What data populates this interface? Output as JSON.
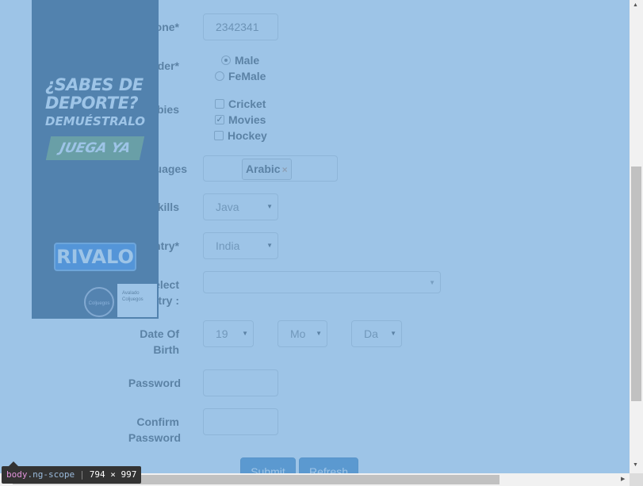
{
  "form": {
    "phone": {
      "label": "Phone*",
      "value": "2342341"
    },
    "gender": {
      "label": "Gender*",
      "options": [
        "Male",
        "FeMale"
      ],
      "selected": "Male"
    },
    "hobbies": {
      "label": "Hobbies",
      "options": [
        {
          "label": "Cricket",
          "checked": false
        },
        {
          "label": "Movies",
          "checked": true
        },
        {
          "label": "Hockey",
          "checked": false
        }
      ]
    },
    "languages": {
      "label": "Languages",
      "tag": "Arabic",
      "remove_symbol": "×"
    },
    "skills": {
      "label": "Skills",
      "value": "Java"
    },
    "country": {
      "label": "Country*",
      "value": "India"
    },
    "select_country": {
      "label_line1": "Select",
      "label_line2": "Country :",
      "value": ""
    },
    "dob": {
      "label_line1": "Date Of",
      "label_line2": "Birth",
      "year": "19",
      "month": "Mo",
      "day": "Da"
    },
    "password": {
      "label": "Password"
    },
    "confirm_password": {
      "label_line1": "Confirm",
      "label_line2": "Password"
    },
    "buttons": {
      "submit": "Submit",
      "refresh": "Refresh"
    }
  },
  "ad": {
    "headline": "¿SABES DE DEPORTE?",
    "subline": "DEMUÉSTRALO",
    "cta": "JUEGA YA",
    "brand": "RIVALO",
    "seal": "Coljuegos",
    "badge_line1": "Avalado",
    "badge_line2": "Coljuegos"
  },
  "devtools_tooltip": {
    "tag": "body",
    "class": ".ng-scope",
    "size": "794 × 997"
  },
  "colors": {
    "overlay": "#6fa8dc",
    "primary_button": "#337ab7"
  }
}
